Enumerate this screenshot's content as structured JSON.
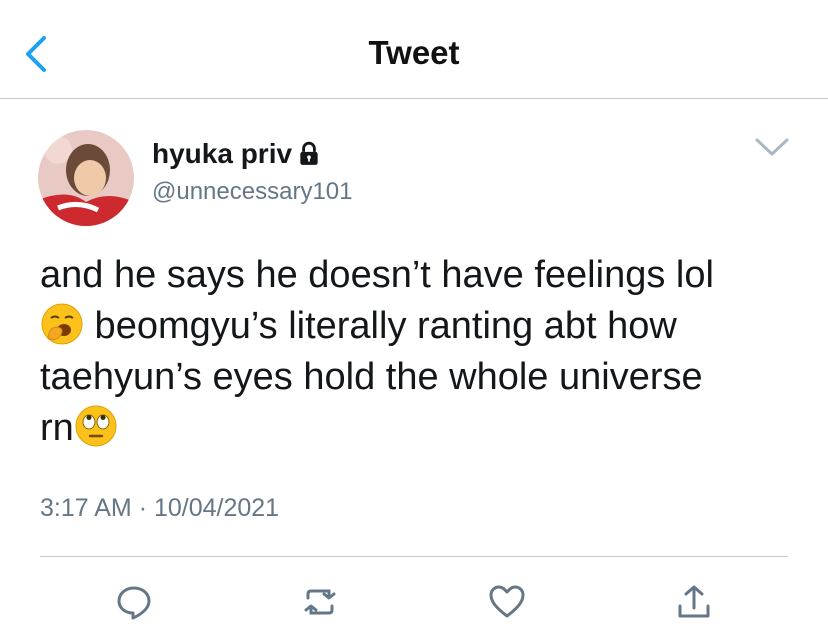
{
  "header": {
    "title": "Tweet",
    "back_icon": "chevron-left-icon",
    "accent": "#1da1f2"
  },
  "tweet": {
    "display_name": "hyuka priv",
    "handle": "@unnecessary101",
    "protected_icon": "lock-icon",
    "text_line1": "and he says he doesn’t have feelings lol",
    "text_line2": " beomgyu’s literally ranting abt how",
    "text_line3": "taehyun’s eyes hold the whole universe",
    "text_line4": "rn",
    "emoji1": "yawning-face-emoji",
    "emoji2": "eye-roll-emoji",
    "time": "3:17 AM",
    "separator": "·",
    "date": "10/04/2021"
  },
  "actions": [
    "reply-icon",
    "retweet-icon",
    "like-icon",
    "share-icon"
  ],
  "colors": {
    "text": "#14171a",
    "muted": "#657786",
    "icon": "#657786"
  }
}
